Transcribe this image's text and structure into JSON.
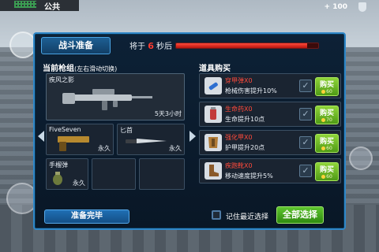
{
  "hud": {
    "public_label": "公共",
    "health_value": "+ 100"
  },
  "panel": {
    "title": "战斗准备",
    "timer_prefix": "将于",
    "timer_seconds": "6",
    "timer_suffix": "秒后",
    "timer_progress": 0.92
  },
  "weapons": {
    "header": "当前枪组",
    "header_hint": "(左右滑动切换)",
    "primary": {
      "name": "疾风之影",
      "duration": "5天3小时"
    },
    "pistol": {
      "name": "FiveSeven",
      "duration": "永久"
    },
    "knife": {
      "name": "匕首",
      "duration": "永久"
    },
    "grenade": {
      "name": "手榴弹",
      "duration": "永久"
    }
  },
  "shop": {
    "header": "道具购买",
    "items": [
      {
        "name": "穿甲弹X0",
        "desc": "枪械伤害提升10%",
        "buy_label": "购买",
        "price": "60",
        "icon": "bullet-icon"
      },
      {
        "name": "生命药X0",
        "desc": "生命提升10点",
        "buy_label": "购买",
        "price": "70",
        "icon": "potion-icon"
      },
      {
        "name": "强化甲X0",
        "desc": "护甲提升20点",
        "buy_label": "购买",
        "price": "60",
        "icon": "armor-icon"
      },
      {
        "name": "疾跑靴X0",
        "desc": "移动速度提升5%",
        "buy_label": "购买",
        "price": "60",
        "icon": "boots-icon"
      }
    ]
  },
  "bottom": {
    "ready_label": "准备完毕",
    "remember_label": "记住最近选择",
    "buy_all_label": "全部选择"
  }
}
